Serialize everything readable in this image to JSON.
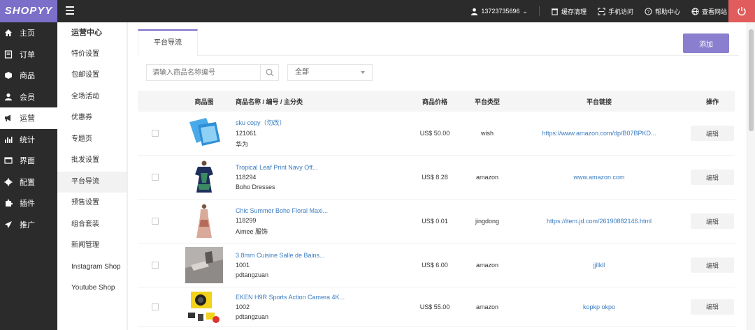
{
  "brand": "SHOPYY",
  "topbar": {
    "user": "13723735696",
    "cache": "缓存清理",
    "mobile": "手机访问",
    "help": "帮助中心",
    "site": "查看网站"
  },
  "nav": [
    {
      "label": "主页",
      "icon": "home-icon"
    },
    {
      "label": "订单",
      "icon": "order-icon"
    },
    {
      "label": "商品",
      "icon": "box-icon"
    },
    {
      "label": "会员",
      "icon": "user-icon"
    },
    {
      "label": "运营",
      "icon": "megaphone-icon"
    },
    {
      "label": "统计",
      "icon": "chart-icon"
    },
    {
      "label": "界面",
      "icon": "window-icon"
    },
    {
      "label": "配置",
      "icon": "gear-icon"
    },
    {
      "label": "插件",
      "icon": "puzzle-icon"
    },
    {
      "label": "推广",
      "icon": "plane-icon"
    }
  ],
  "subnav": {
    "title": "运营中心",
    "items": [
      "特价设置",
      "包邮设置",
      "全场活动",
      "优惠券",
      "专题页",
      "批发设置",
      "平台导流",
      "预售设置",
      "组合套装",
      "新闻管理",
      "Instagram Shop",
      "Youtube Shop"
    ]
  },
  "tab": "平台导流",
  "add_button": "添加",
  "search": {
    "placeholder": "请输入商品名称编号"
  },
  "filter": {
    "selected": "全部"
  },
  "table": {
    "headers": {
      "image": "商品图",
      "name": "商品名称 / 编号 / 主分类",
      "price": "商品价格",
      "type": "平台类型",
      "link": "平台链接",
      "op": "操作"
    },
    "rows": [
      {
        "name": "sku copy（勿改）",
        "code": "121061",
        "category": "华为",
        "price": "US$ 50.00",
        "type": "wish",
        "link": "https://www.amazon.com/dp/B07BPKD...",
        "edit": "编辑",
        "img": "phone"
      },
      {
        "name": "Tropical Leaf Print Navy Off...",
        "code": "118294",
        "category": "Boho Dresses",
        "price": "US$ 8.28",
        "type": "amazon",
        "link": "www.amazon.com",
        "edit": "编辑",
        "img": "dress1"
      },
      {
        "name": "Chic Summer Boho Floral Maxi...",
        "code": "118299",
        "category": "Aimee 服饰",
        "price": "US$ 0.01",
        "type": "jingdong",
        "link": "https://item.jd.com/26190882146.html",
        "edit": "编辑",
        "img": "dress2"
      },
      {
        "name": "3.8mm Cuisine Salle de Bains...",
        "code": "1001",
        "category": "pdtangzuan",
        "price": "US$ 6.00",
        "type": "amazon",
        "link": "jjllkll",
        "edit": "编辑",
        "img": "tool"
      },
      {
        "name": "EKEN H9R Sports Action Camera 4K...",
        "code": "1002",
        "category": "pdtangzuan",
        "price": "US$ 55.00",
        "type": "amazon",
        "link": "kopkp okpo",
        "edit": "编辑",
        "img": "camera"
      }
    ]
  }
}
